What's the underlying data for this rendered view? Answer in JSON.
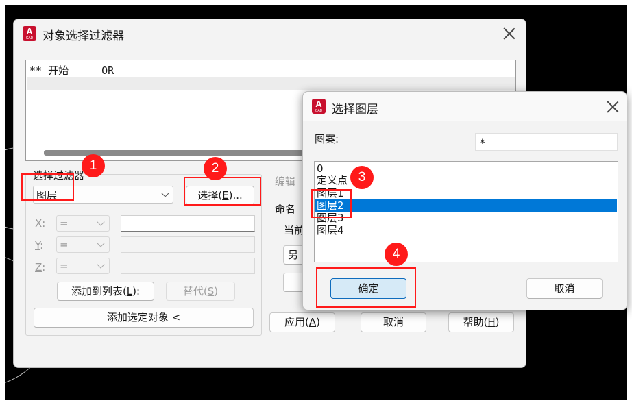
{
  "icon": {
    "letter": "A",
    "sub": "CAD"
  },
  "main_dialog": {
    "title": "对象选择过滤器",
    "filter_list": [
      {
        "stars": "**",
        "text": "开始",
        "op": "OR"
      }
    ],
    "select_filter": {
      "group_label": "选择过滤器",
      "type_value": "图层",
      "select_button": "选择(E)...",
      "x_label": "X:",
      "y_label": "Y:",
      "z_label": "Z:",
      "op_value": "=",
      "add_to_list": "添加到列表(L):",
      "substitute": "替代(S)",
      "add_selected": "添加选定对象 <"
    },
    "edit_label": "编辑",
    "named_label": "命名",
    "current_label": "当前",
    "save_as_partial": "另",
    "apply": "应用(A)",
    "cancel": "取消",
    "help": "帮助(H)"
  },
  "layer_dialog": {
    "title": "选择图层",
    "pattern_label": "图案:",
    "pattern_value": "*",
    "layers": [
      "0",
      "定义点",
      "图层1",
      "图层2",
      "图层3",
      "图层4"
    ],
    "selected": "图层2",
    "ok": "确定",
    "cancel": "取消"
  },
  "annotations": [
    "1",
    "2",
    "3",
    "4"
  ],
  "colors": {
    "highlight": "#0078d7",
    "annotation": "#ff1a1a",
    "primary_border": "#0f6cbd"
  }
}
